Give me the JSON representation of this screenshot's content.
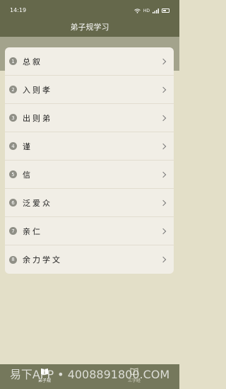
{
  "status": {
    "time": "14:19",
    "hd": "HD"
  },
  "header": {
    "title": "弟子规学习"
  },
  "list": [
    {
      "num": "1",
      "label": "总叙"
    },
    {
      "num": "2",
      "label": "入则孝"
    },
    {
      "num": "3",
      "label": "出则弟"
    },
    {
      "num": "4",
      "label": "谨"
    },
    {
      "num": "5",
      "label": "信"
    },
    {
      "num": "6",
      "label": "泛爱众"
    },
    {
      "num": "7",
      "label": "亲仁"
    },
    {
      "num": "8",
      "label": "余力学文"
    }
  ],
  "tabs": [
    {
      "label": "弟子规",
      "icon": "book-icon",
      "active": true
    },
    {
      "label": "三字经",
      "icon": "book-icon",
      "active": false
    }
  ],
  "watermark": "易下APP • 4008891800.COM",
  "colors": {
    "header": "#65684b",
    "background": "#e3dfc8",
    "card": "#f1eee6",
    "nav": "#75785c"
  }
}
